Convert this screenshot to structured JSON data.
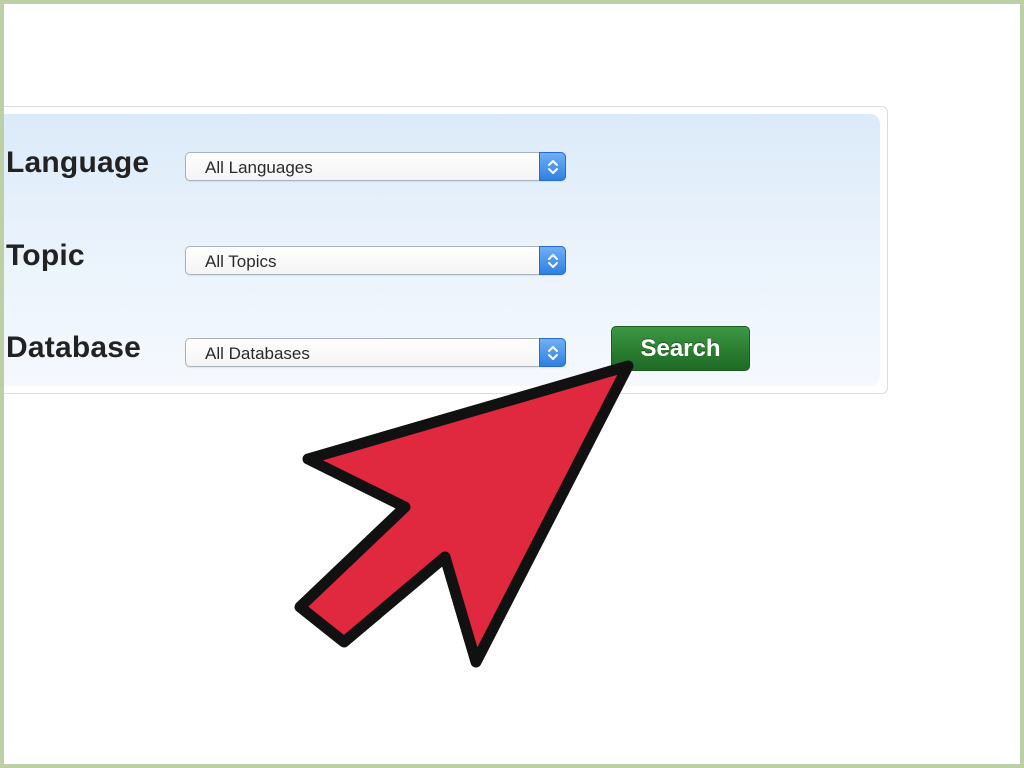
{
  "form": {
    "rows": [
      {
        "label": "Language",
        "selected": "All Languages"
      },
      {
        "label": "Topic",
        "selected": "All Topics"
      },
      {
        "label": "Database",
        "selected": "All Databases"
      }
    ],
    "search_button": "Search"
  },
  "annotation": {
    "icon": "red-arrow-pointer-icon",
    "color": "#e0283e"
  }
}
